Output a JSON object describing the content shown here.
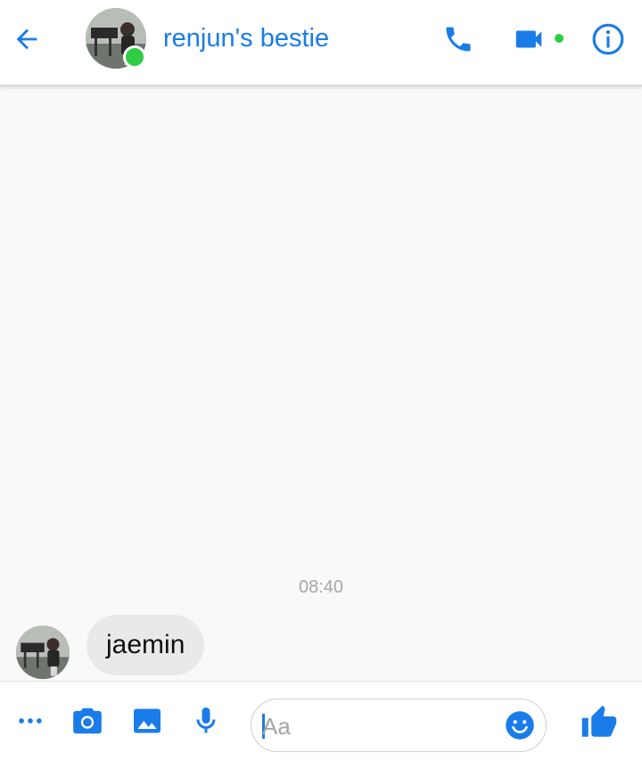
{
  "header": {
    "title": "renjun's bestie",
    "contact_online": true,
    "icons": {
      "back": "arrow-left-icon",
      "call": "phone-icon",
      "video": "video-camera-icon",
      "info": "info-icon"
    }
  },
  "conversation": {
    "timestamp": "08:40",
    "messages": [
      {
        "text": "jaemin",
        "direction": "incoming"
      }
    ]
  },
  "composer": {
    "placeholder": "Aa",
    "value": "",
    "icons": [
      "more-icon",
      "camera-icon",
      "gallery-icon",
      "microphone-icon",
      "emoji-icon",
      "thumbs-up-icon"
    ]
  },
  "colors": {
    "accent": "#1a7ce8",
    "online": "#31cc46",
    "bubble": "#e9e9e9",
    "background": "#f9f9f9"
  }
}
